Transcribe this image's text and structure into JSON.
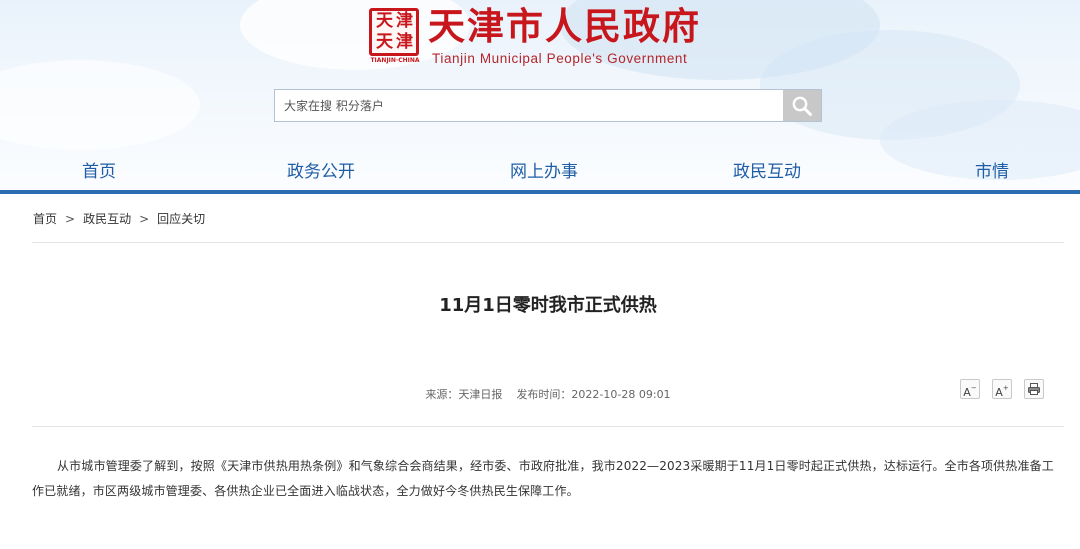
{
  "header": {
    "seal_chars": [
      "天",
      "津",
      "天",
      "津"
    ],
    "seal_caption": "TIANJIN·CHINA",
    "title": "天津市人民政府",
    "subtitle": "Tianjin Municipal People's Government",
    "brand_color": "#c8161d"
  },
  "search": {
    "placeholder": "大家在搜 积分落户",
    "icon": "search-icon"
  },
  "nav": {
    "items": [
      {
        "label": "首页"
      },
      {
        "label": "政务公开"
      },
      {
        "label": "网上办事"
      },
      {
        "label": "政民互动"
      },
      {
        "label": "市情"
      }
    ],
    "accent_color": "#2b6cb3"
  },
  "breadcrumb": {
    "items": [
      {
        "label": "首页"
      },
      {
        "label": "政民互动"
      },
      {
        "label": "回应关切"
      }
    ],
    "separator": ">"
  },
  "article": {
    "title": "11月1日零时我市正式供热",
    "source": "来源：天津日报",
    "published": "发布时间：2022-10-28 09:01",
    "tools": [
      {
        "label": "A",
        "suffix": "−",
        "icon": "font-decrease-icon"
      },
      {
        "label": "A",
        "suffix": "+",
        "icon": "font-increase-icon"
      },
      {
        "icon": "print-icon"
      }
    ],
    "body": "从市城市管理委了解到，按照《天津市供热用热条例》和气象综合会商结果，经市委、市政府批准，我市2022—2023采暖期于11月1日零时起正式供热，达标运行。全市各项供热准备工作已就绪，市区两级城市管理委、各供热企业已全面进入临战状态，全力做好今冬供热民生保障工作。"
  }
}
